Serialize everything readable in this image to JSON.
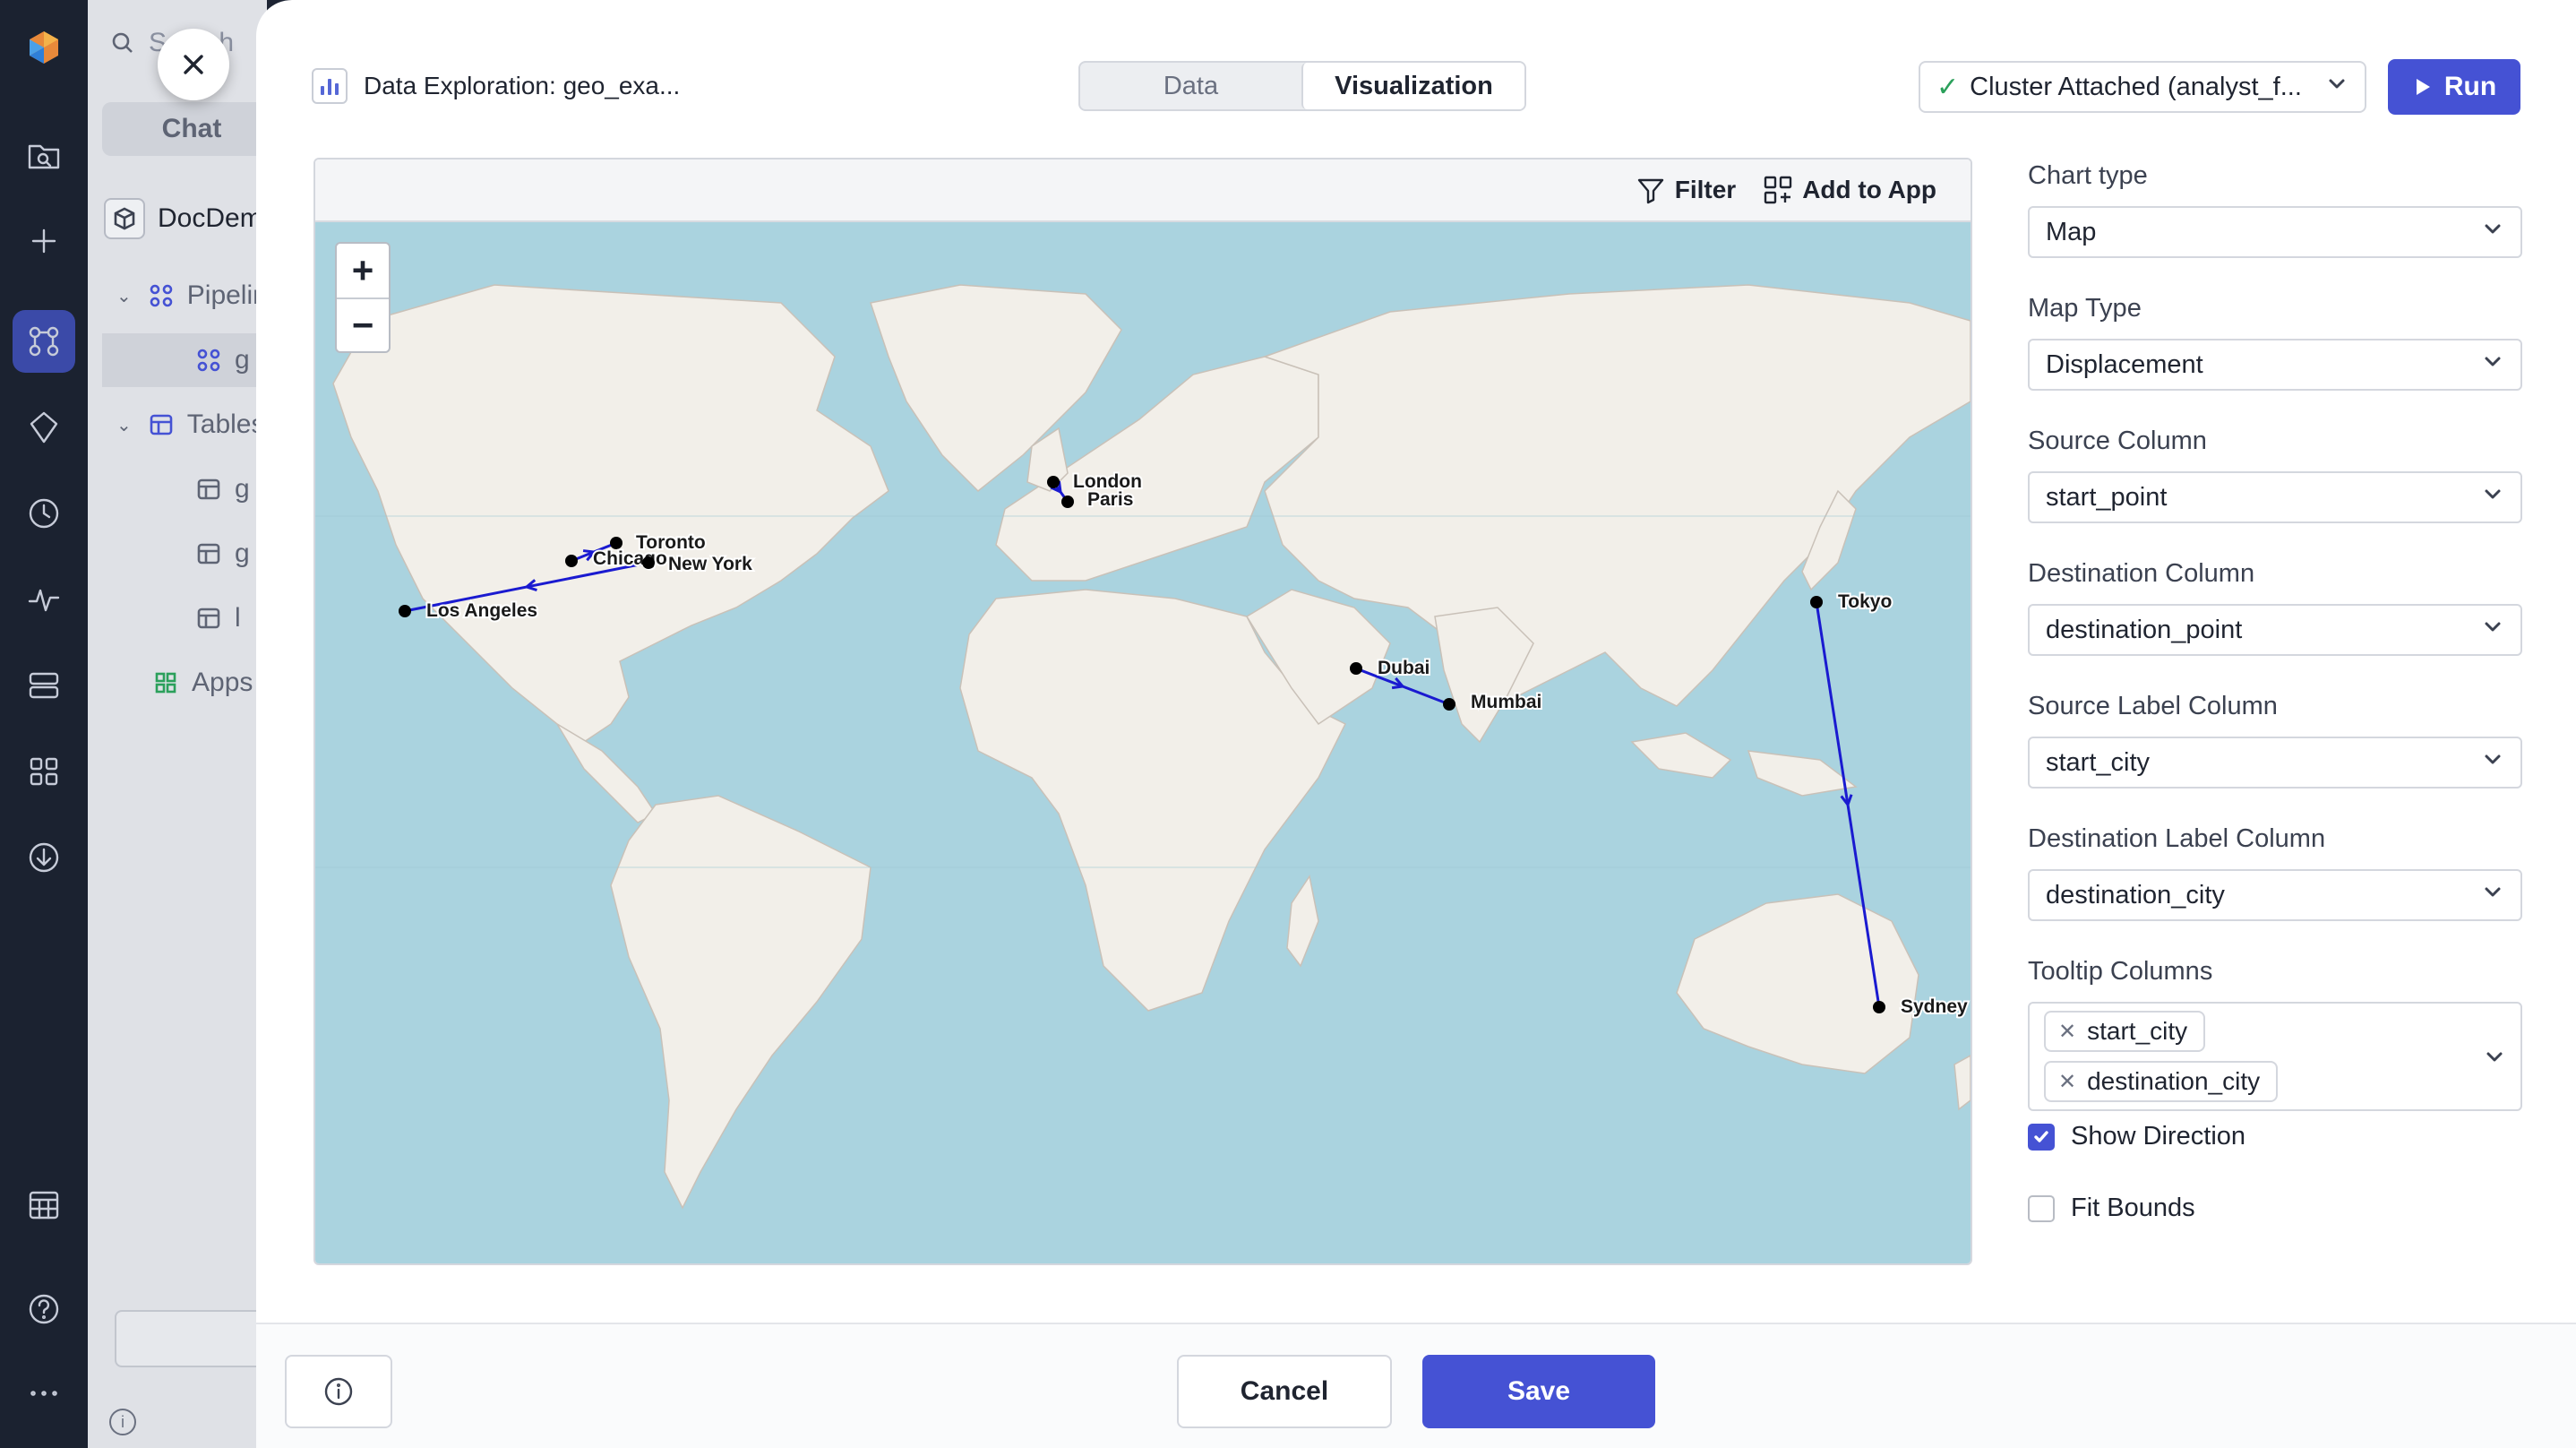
{
  "background": {
    "search_placeholder": "Search",
    "chat_tab": "Chat",
    "tree": [
      "DocDemo",
      "Pipelines",
      "g",
      "Tables",
      "g",
      "g",
      "l",
      "Apps"
    ]
  },
  "modal": {
    "title": "Data Exploration: geo_exa...",
    "tabs": [
      "Data",
      "Visualization"
    ],
    "active_tab": "Visualization",
    "cluster": "Cluster Attached (analyst_f...",
    "run_label": "Run"
  },
  "map": {
    "toolbar": {
      "filter": "Filter",
      "add_to_app": "Add to App"
    },
    "zoom_in": "+",
    "zoom_out": "−",
    "routes": [
      {
        "from": "Chicago",
        "to": "Toronto"
      },
      {
        "from": "New York",
        "to": "Los Angeles"
      },
      {
        "from": "London",
        "to": "Paris"
      },
      {
        "from": "Dubai",
        "to": "Mumbai"
      },
      {
        "from": "Tokyo",
        "to": "Sydney"
      }
    ],
    "cities": [
      "Toronto",
      "Chicago",
      "New York",
      "Los Angeles",
      "London",
      "Paris",
      "Dubai",
      "Mumbai",
      "Tokyo",
      "Sydney"
    ],
    "route_color": "#1a1ad0",
    "land_color": "#f2efe9",
    "water_color": "#aad3df"
  },
  "controls": {
    "chart_type": {
      "label": "Chart type",
      "value": "Map"
    },
    "map_type": {
      "label": "Map Type",
      "value": "Displacement"
    },
    "source_column": {
      "label": "Source Column",
      "value": "start_point"
    },
    "destination_column": {
      "label": "Destination Column",
      "value": "destination_point"
    },
    "source_label_column": {
      "label": "Source Label Column",
      "value": "start_city"
    },
    "destination_label_column": {
      "label": "Destination Label Column",
      "value": "destination_city"
    },
    "tooltip_columns": {
      "label": "Tooltip Columns",
      "values": [
        "start_city",
        "destination_city"
      ]
    },
    "show_direction": {
      "label": "Show Direction",
      "checked": true
    },
    "fit_bounds": {
      "label": "Fit Bounds",
      "checked": false
    }
  },
  "footer": {
    "cancel": "Cancel",
    "save": "Save"
  },
  "accent_color": "#4552d4"
}
